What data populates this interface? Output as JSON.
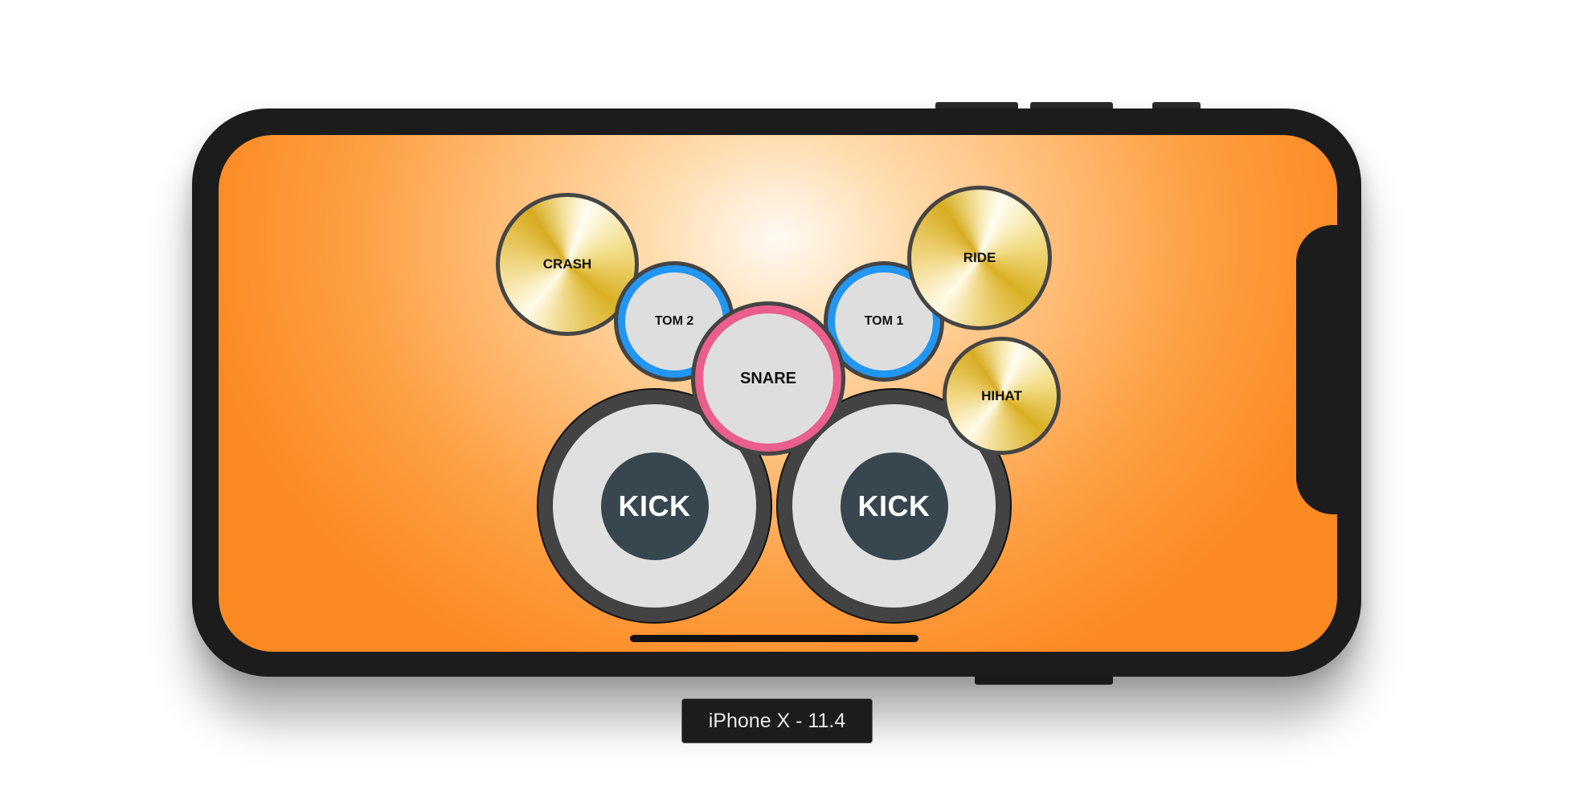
{
  "device": {
    "label": "iPhone X - 11.4"
  },
  "drums": {
    "crash": "CRASH",
    "tom2": "TOM 2",
    "tom1": "TOM 1",
    "ride": "RIDE",
    "snare": "SNARE",
    "hihat": "HIHAT",
    "kick_left": "KICK",
    "kick_right": "KICK"
  },
  "colors": {
    "background_center": "#fffaf3",
    "background_edge": "#fb8a22",
    "tom_ring": "#2196f3",
    "snare_ring": "#ea5f8b",
    "kick_center": "#37464f",
    "cymbal_gold": "#d9b024"
  }
}
